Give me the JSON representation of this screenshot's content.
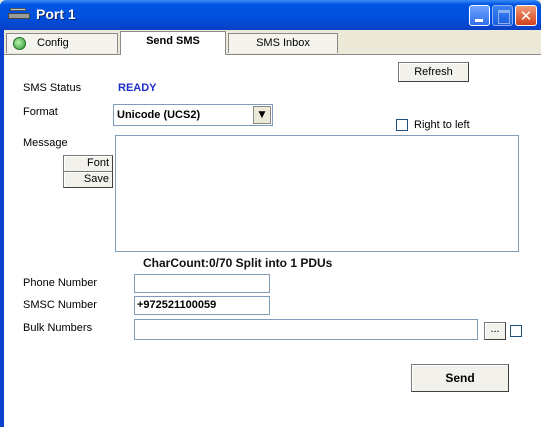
{
  "window": {
    "title": "Port 1"
  },
  "tabs": [
    {
      "label": "Config",
      "icon": "globe-icon"
    },
    {
      "label": "Send SMS"
    },
    {
      "label": "SMS Inbox"
    }
  ],
  "refresh_label": "Refresh",
  "sms_status": {
    "label": "SMS Status",
    "value": "READY"
  },
  "format": {
    "label": "Format",
    "selected": "Unicode (UCS2)"
  },
  "right_to_left": {
    "label": "Right to left",
    "checked": false
  },
  "message": {
    "label": "Message",
    "font_label": "Font",
    "save_label": "Save",
    "value": ""
  },
  "charcount": "CharCount:0/70  Split into 1 PDUs",
  "phone_number": {
    "label": "Phone Number",
    "value": ""
  },
  "smsc_number": {
    "label": "SMSC Number",
    "value": "+972521100059"
  },
  "bulk_numbers": {
    "label": "Bulk Numbers",
    "value": "",
    "browse_label": "...",
    "checked": false
  },
  "send_label": "Send",
  "colors": {
    "status": "#1f2fc7",
    "titlebar": "#0055e5"
  }
}
